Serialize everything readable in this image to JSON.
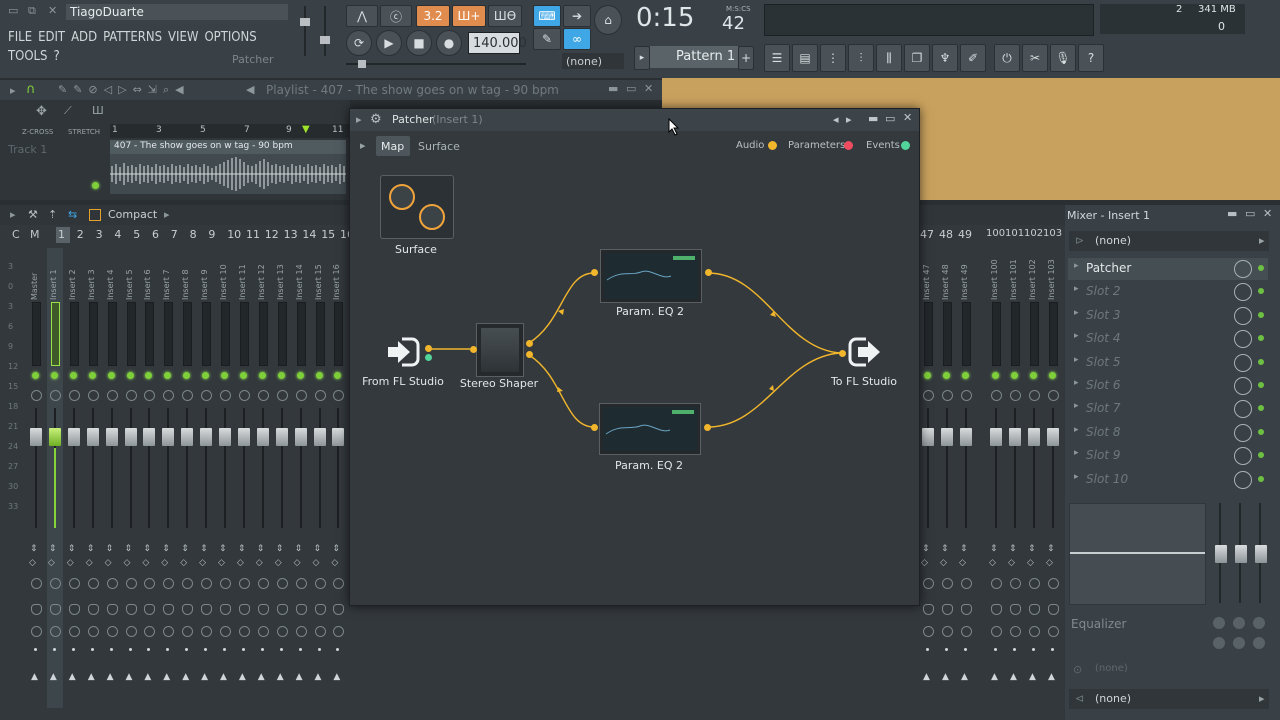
{
  "topbar": {
    "user": "TiagoDuarte",
    "menu": [
      "FILE",
      "EDIT",
      "ADD",
      "PATTERNS",
      "VIEW",
      "OPTIONS",
      "TOOLS",
      "?"
    ],
    "hint": "Patcher",
    "tempo": "140.000",
    "time": "0:15",
    "time_small": "42",
    "time_label": "M:S:CS",
    "pattern": "Pattern 1",
    "pattern_none": "(none)",
    "cpu": "2",
    "memory": "341 MB",
    "voices": "0",
    "btn_labels": [
      "3.2",
      "Ш+",
      "ШӨ"
    ]
  },
  "playlist": {
    "title": "Playlist - 407 - The show goes on w tag - 90 bpm",
    "track": "Track 1",
    "clip": "407 - The show goes on w tag - 90 bpm",
    "zcross": "Z-CROSS",
    "stretch": "STRETCH",
    "ruler": [
      "1",
      "3",
      "5",
      "7",
      "9",
      "11"
    ]
  },
  "mixer_bar": {
    "view": "Compact",
    "cm": [
      "C",
      "M"
    ]
  },
  "mixer": {
    "numbers": [
      "1",
      "2",
      "3",
      "4",
      "5",
      "6",
      "7",
      "8",
      "9",
      "10",
      "11",
      "12",
      "13",
      "14",
      "15",
      "16"
    ],
    "numbers_right": [
      "47",
      "48",
      "49"
    ],
    "numbers_far": [
      "100",
      "101",
      "102",
      "103"
    ],
    "strip_names": [
      "Master",
      "Insert 1",
      "Insert 2",
      "Insert 3",
      "Insert 4",
      "Insert 5",
      "Insert 6",
      "Insert 7",
      "Insert 8",
      "Insert 9",
      "Insert 10",
      "Insert 11",
      "Insert 12",
      "Insert 13",
      "Insert 14",
      "Insert 15",
      "Insert 16"
    ],
    "strip_names_right": [
      "Insert 47",
      "Insert 48",
      "Insert 49"
    ],
    "strip_names_far": [
      "Insert 100",
      "Insert 101",
      "Insert 102",
      "Insert 103"
    ],
    "db_scale": [
      "3",
      "0",
      "3",
      "6",
      "9",
      "12",
      "15",
      "18",
      "21",
      "24",
      "27",
      "30",
      "33"
    ]
  },
  "mixer_panel": {
    "title": "Mixer - Insert 1",
    "input": "(none)",
    "output": "(none)",
    "slots": [
      "Patcher",
      "Slot 2",
      "Slot 3",
      "Slot 4",
      "Slot 5",
      "Slot 6",
      "Slot 7",
      "Slot 8",
      "Slot 9",
      "Slot 10"
    ],
    "eq_label": "Equalizer",
    "eq_none": "(none)"
  },
  "patcher": {
    "title": "Patcher",
    "subtitle": "(Insert 1)",
    "tabs": [
      "Map",
      "Surface"
    ],
    "legend": [
      "Audio",
      "Parameters",
      "Events"
    ],
    "nodes": {
      "surface": "Surface",
      "from": "From FL Studio",
      "shaper": "Stereo Shaper",
      "eq_top": "Param. EQ 2",
      "eq_bottom": "Param. EQ 2",
      "to": "To FL Studio"
    }
  },
  "colors": {
    "audio": "#f2b62c",
    "parameters": "#ef4d5f",
    "events": "#52d39a",
    "accent_orange": "#e08c4e",
    "accent_blue": "#3fa7e6",
    "tan": "#c9a15e"
  }
}
